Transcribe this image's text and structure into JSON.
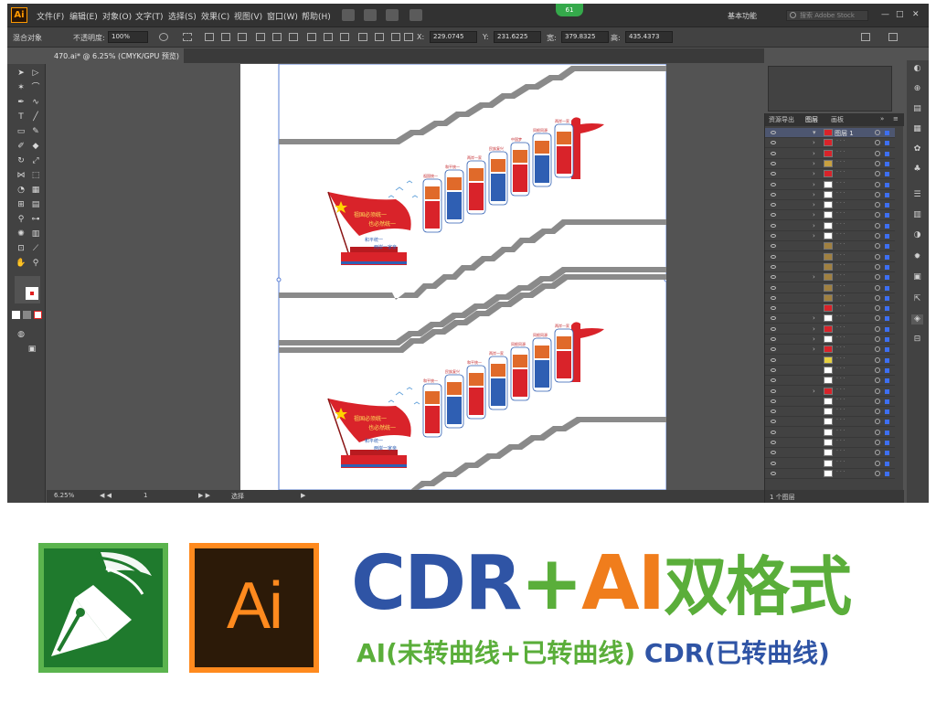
{
  "app": {
    "logo": "Ai",
    "menu": [
      "文件(F)",
      "编辑(E)",
      "对象(O)",
      "文字(T)",
      "选择(S)",
      "效果(C)",
      "视图(V)",
      "窗口(W)",
      "帮助(H)"
    ],
    "badge": "61",
    "workspace": "基本功能",
    "search_placeholder": "搜索 Adobe Stock",
    "window_buttons": [
      "—",
      "□",
      "✕"
    ]
  },
  "control_bar": {
    "selection_label": "混合对象",
    "opacity_label": "不透明度:",
    "opacity_value": "100%",
    "x_label": "X:",
    "x_value": "229.0745",
    "y_label": "Y:",
    "y_value": "231.6225",
    "w_label": "宽:",
    "w_value": "379.8325",
    "h_label": "高:",
    "h_value": "435.4373"
  },
  "document": {
    "tab_title": "470.ai* @ 6.25% (CMYK/GPU 预览)"
  },
  "status_bar": {
    "zoom": "6.25%",
    "artboard_number": "1",
    "tool_name": "选择"
  },
  "panels": {
    "tabs": [
      "资源导出",
      "图层",
      "画板"
    ],
    "active_tab": "图层",
    "top_layer_name": "图层 1",
    "footer_text": "1 个图层"
  },
  "artwork": {
    "slogan_top_1": "祖国必须统一",
    "slogan_top_2": "也必然统一",
    "slogan_bottom_1": "和平统一",
    "slogan_bottom_2": "两岸一家亲",
    "panel_titles_upper": [
      "祖国统一",
      "和平统一",
      "两岸一家",
      "民族复兴",
      "中国梦",
      "同根同源",
      "两岸一家"
    ],
    "panel_titles_lower": [
      "和平统一",
      "民族复兴",
      "和平统一",
      "两岸一家",
      "同根同源",
      "同根同源",
      "两岸一家"
    ]
  },
  "banner": {
    "cdr_part": "CDR",
    "plus_part": "+",
    "ai_part": "AI",
    "format_part": "双格式",
    "sub_ai": "AI(未转曲线+已转曲线)",
    "sub_cdr": "CDR(已转曲线)",
    "ai_icon_text": "Ai"
  },
  "colors": {
    "cdr_blue": "#2f54a5",
    "green": "#5aae3a",
    "ai_orange": "#f07d1c",
    "flag_red": "#d9232a",
    "panel_blue": "#2f5fb3"
  }
}
